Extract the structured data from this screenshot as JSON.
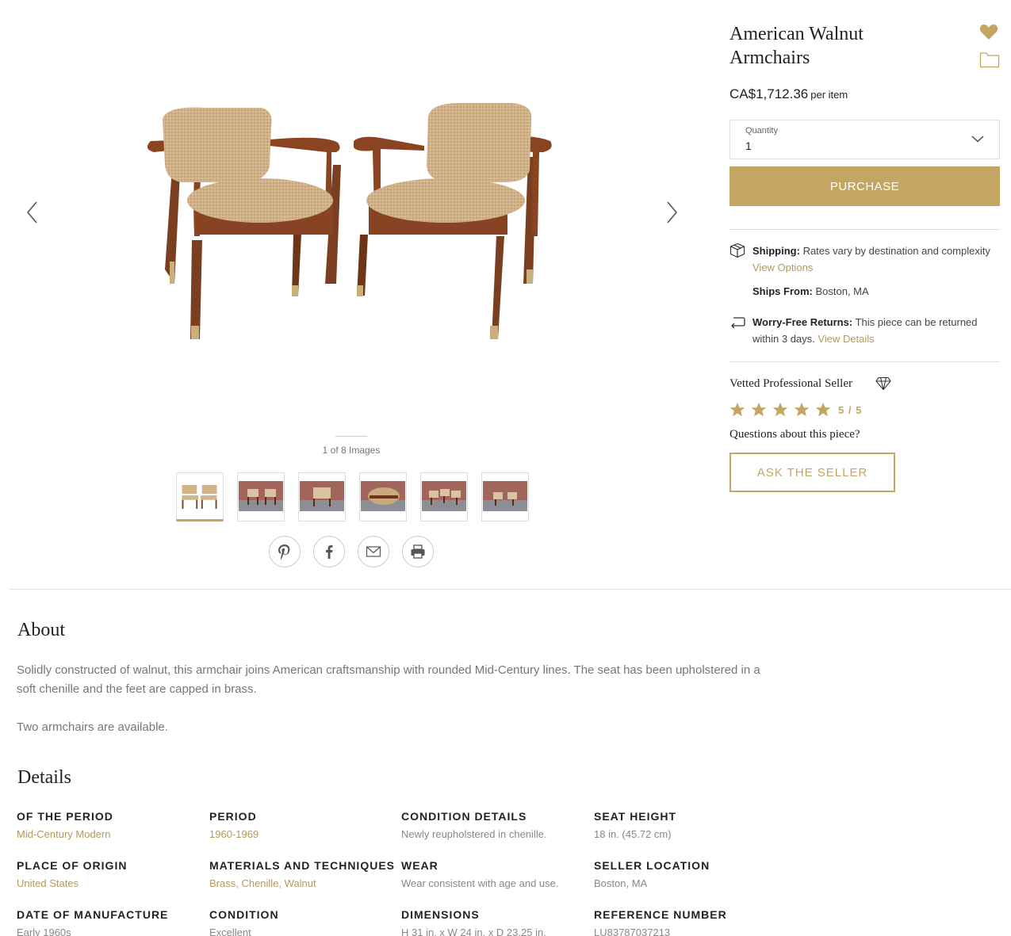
{
  "gallery": {
    "counter": "1 of 8 Images",
    "thumbnail_count": 6
  },
  "product": {
    "title_line1": "American Walnut",
    "title_line2": "Armchairs",
    "price": "CA$1,712.36",
    "price_unit": "per item",
    "quantity_label": "Quantity",
    "quantity_value": "1",
    "purchase_label": "PURCHASE"
  },
  "shipping": {
    "shipping_label": "Shipping:",
    "shipping_text": "Rates vary by destination and complexity",
    "view_options": "View Options",
    "ships_from_label": "Ships From:",
    "ships_from_value": "Boston, MA",
    "returns_label": "Worry-Free Returns:",
    "returns_text": "This piece can be returned within 3 days.",
    "view_details": "View Details"
  },
  "seller": {
    "vetted": "Vetted Professional Seller",
    "rating": "5 / 5",
    "rating_value": 5,
    "rating_max": 5,
    "questions": "Questions about this piece?",
    "ask_label": "ASK THE SELLER"
  },
  "about": {
    "heading": "About",
    "paragraph1": "Solidly constructed of walnut, this armchair joins American craftsmanship with rounded Mid-Century lines. The seat has been upholstered in a soft chenille and the feet are capped in brass.",
    "paragraph2": "Two armchairs are available."
  },
  "details": {
    "heading": "Details",
    "items": [
      {
        "label": "OF THE PERIOD",
        "value": "Mid-Century Modern"
      },
      {
        "label": "PERIOD",
        "value": "1960-1969"
      },
      {
        "label": "CONDITION DETAILS",
        "value": "Newly reupholstered in chenille."
      },
      {
        "label": "SEAT HEIGHT",
        "value": "18 in. (45.72 cm)"
      },
      {
        "label": "PLACE OF ORIGIN",
        "value": "United States"
      },
      {
        "label": "MATERIALS AND TECHNIQUES",
        "value": "Brass, Chenille, Walnut"
      },
      {
        "label": "WEAR",
        "value": "Wear consistent with age and use."
      },
      {
        "label": "SELLER LOCATION",
        "value": "Boston, MA"
      },
      {
        "label": "DATE OF MANUFACTURE",
        "value": "Early 1960s"
      },
      {
        "label": "CONDITION",
        "value": "Excellent"
      },
      {
        "label": "DIMENSIONS",
        "value": "H 31 in. x W 24 in. x D 23.25 in."
      },
      {
        "label": "REFERENCE NUMBER",
        "value": "LU83787037213"
      }
    ]
  },
  "colors": {
    "accent": "#c2a661",
    "link": "#b39a5c"
  }
}
